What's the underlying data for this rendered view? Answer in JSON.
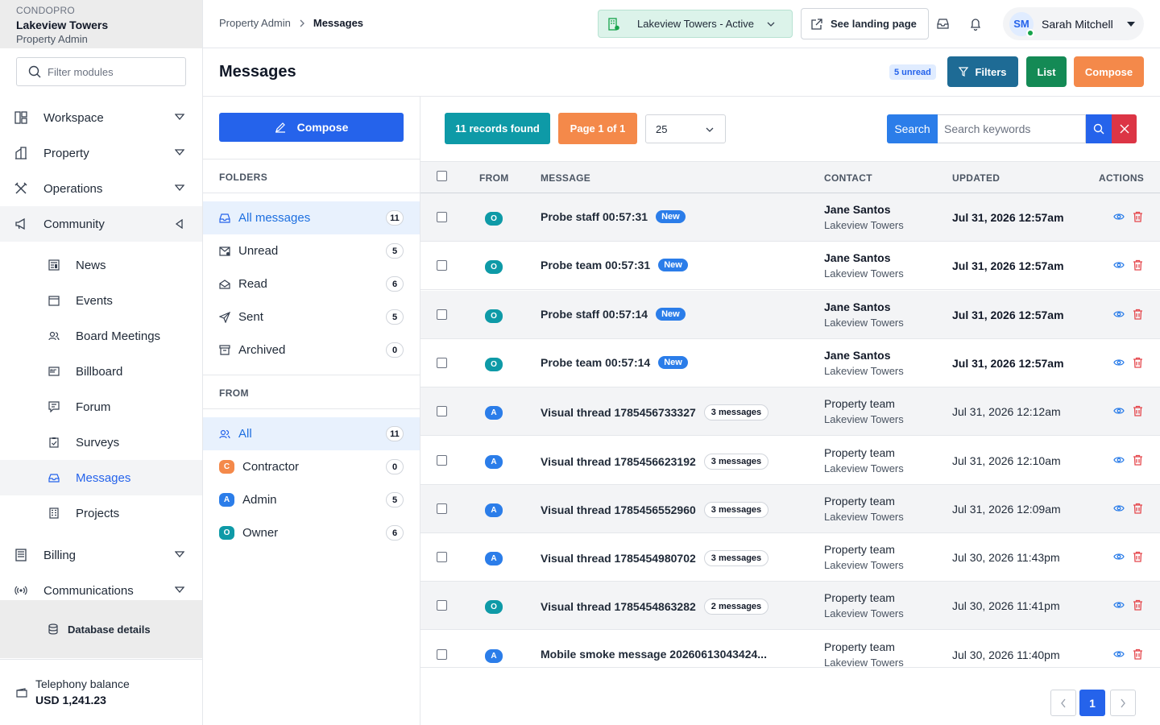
{
  "brand": {
    "small": "CONDOPRO",
    "title": "Lakeview Towers",
    "role": "Property Admin"
  },
  "sidebar": {
    "filter_placeholder": "Filter modules",
    "nav": [
      {
        "label": "Workspace",
        "icon": "workspace-icon"
      },
      {
        "label": "Property",
        "icon": "building-icon"
      },
      {
        "label": "Operations",
        "icon": "tools-icon"
      },
      {
        "label": "Community",
        "icon": "megaphone-icon"
      }
    ],
    "community_items": [
      {
        "label": "News"
      },
      {
        "label": "Events"
      },
      {
        "label": "Board Meetings"
      },
      {
        "label": "Billboard"
      },
      {
        "label": "Forum"
      },
      {
        "label": "Surveys"
      },
      {
        "label": "Messages"
      },
      {
        "label": "Projects"
      }
    ],
    "nav_bottom": [
      {
        "label": "Billing"
      },
      {
        "label": "Communications"
      }
    ],
    "db_label": "Database details",
    "telephony_label": "Telephony balance",
    "telephony_value": "USD 1,241.23"
  },
  "topbar": {
    "breadcrumb_parent": "Property Admin",
    "breadcrumb_current": "Messages",
    "property_selector": "Lakeview Towers - Active",
    "landing_label": "See landing page",
    "user_initials": "SM",
    "user_name": "Sarah Mitchell"
  },
  "page": {
    "title": "Messages",
    "unread_badge": "5 unread",
    "filters_label": "Filters",
    "list_label": "List",
    "compose_label": "Compose"
  },
  "folders": {
    "compose_label": "Compose",
    "folders_heading": "FOLDERS",
    "items": [
      {
        "label": "All messages",
        "count": "11"
      },
      {
        "label": "Unread",
        "count": "5"
      },
      {
        "label": "Read",
        "count": "6"
      },
      {
        "label": "Sent",
        "count": "5"
      },
      {
        "label": "Archived",
        "count": "0"
      }
    ],
    "from_heading": "FROM",
    "from_items": [
      {
        "label": "All",
        "count": "11",
        "badge": ""
      },
      {
        "label": "Contractor",
        "count": "0",
        "badge": "C"
      },
      {
        "label": "Admin",
        "count": "5",
        "badge": "A"
      },
      {
        "label": "Owner",
        "count": "6",
        "badge": "O"
      }
    ]
  },
  "toolbar": {
    "records_label": "11 records found",
    "page_label": "Page 1 of 1",
    "page_size": "25",
    "search_label": "Search",
    "search_placeholder": "Search keywords"
  },
  "table": {
    "headers": {
      "from": "FROM",
      "message": "MESSAGE",
      "contact": "CONTACT",
      "updated": "UPDATED",
      "actions": "ACTIONS"
    },
    "rows": [
      {
        "from": "O",
        "message": "Probe staff 00:57:31",
        "tag": "New",
        "contact": "Jane Santos",
        "property": "Lakeview Towers",
        "updated": "Jul 31, 2026 12:57am",
        "unread": true
      },
      {
        "from": "O",
        "message": "Probe team 00:57:31",
        "tag": "New",
        "contact": "Jane Santos",
        "property": "Lakeview Towers",
        "updated": "Jul 31, 2026 12:57am",
        "unread": true
      },
      {
        "from": "O",
        "message": "Probe staff 00:57:14",
        "tag": "New",
        "contact": "Jane Santos",
        "property": "Lakeview Towers",
        "updated": "Jul 31, 2026 12:57am",
        "unread": true
      },
      {
        "from": "O",
        "message": "Probe team 00:57:14",
        "tag": "New",
        "contact": "Jane Santos",
        "property": "Lakeview Towers",
        "updated": "Jul 31, 2026 12:57am",
        "unread": true
      },
      {
        "from": "A",
        "message": "Visual thread 1785456733327",
        "tag": "3 messages",
        "contact": "Property team",
        "property": "Lakeview Towers",
        "updated": "Jul 31, 2026 12:12am",
        "unread": false
      },
      {
        "from": "A",
        "message": "Visual thread 1785456623192",
        "tag": "3 messages",
        "contact": "Property team",
        "property": "Lakeview Towers",
        "updated": "Jul 31, 2026 12:10am",
        "unread": false
      },
      {
        "from": "A",
        "message": "Visual thread 1785456552960",
        "tag": "3 messages",
        "contact": "Property team",
        "property": "Lakeview Towers",
        "updated": "Jul 31, 2026 12:09am",
        "unread": false
      },
      {
        "from": "A",
        "message": "Visual thread 1785454980702",
        "tag": "3 messages",
        "contact": "Property team",
        "property": "Lakeview Towers",
        "updated": "Jul 30, 2026 11:43pm",
        "unread": false
      },
      {
        "from": "O",
        "message": "Visual thread 1785454863282",
        "tag": "2 messages",
        "contact": "Property team",
        "property": "Lakeview Towers",
        "updated": "Jul 30, 2026 11:41pm",
        "unread": false
      },
      {
        "from": "A",
        "message": "Mobile smoke message 20260613043424...",
        "tag": "",
        "contact": "Property team",
        "property": "Lakeview Towers",
        "updated": "Jul 30, 2026 11:40pm",
        "unread": false
      }
    ]
  },
  "pagination": {
    "current": "1"
  },
  "colors": {
    "primary": "#2563eb",
    "teal": "#0e9aa7",
    "orange": "#f4894a",
    "green": "#16a34a",
    "danger": "#dc3545",
    "owner": "#0e9aa7",
    "admin": "#2b7de9",
    "contractor": "#f4894a"
  }
}
